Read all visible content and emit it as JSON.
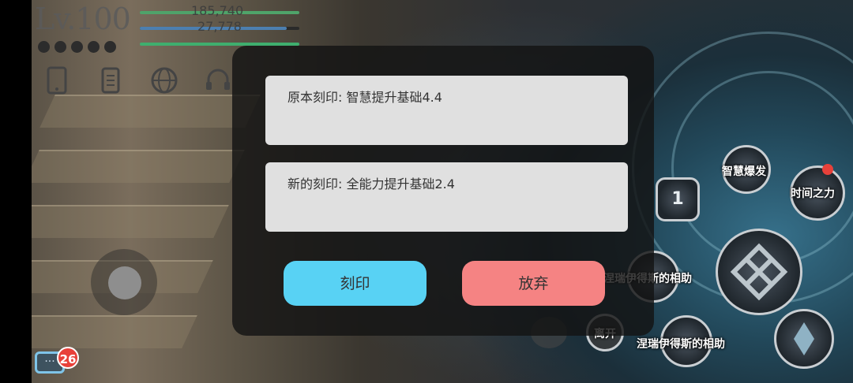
{
  "hud": {
    "level": "Lv.100",
    "hp_value": "185,740",
    "mp_value": "27,778",
    "colors": {
      "hp_bar": "#4fa36a",
      "mp_bar": "#4c7fb0",
      "exp_bar": "#3fae6e"
    },
    "icons": [
      "phone-icon",
      "scroll-icon",
      "globe-icon",
      "headset-icon"
    ]
  },
  "dialog": {
    "original_engraving": "原本刻印: 智慧提升基础4.4",
    "new_engraving": "新的刻印: 全能力提升基础2.4",
    "engrave_button": "刻印",
    "discard_button": "放弃",
    "colors": {
      "engrave": "#58d2f4",
      "discard": "#f58383"
    }
  },
  "skills": {
    "wisdom_burst": "智慧爆发",
    "time_power": "时间之力",
    "slot_number": "1",
    "aid_1": "涅瑞伊得斯的相助",
    "aid_2": "涅瑞伊得斯的相助",
    "leave": "离开"
  },
  "chat": {
    "badge_count": "26"
  }
}
